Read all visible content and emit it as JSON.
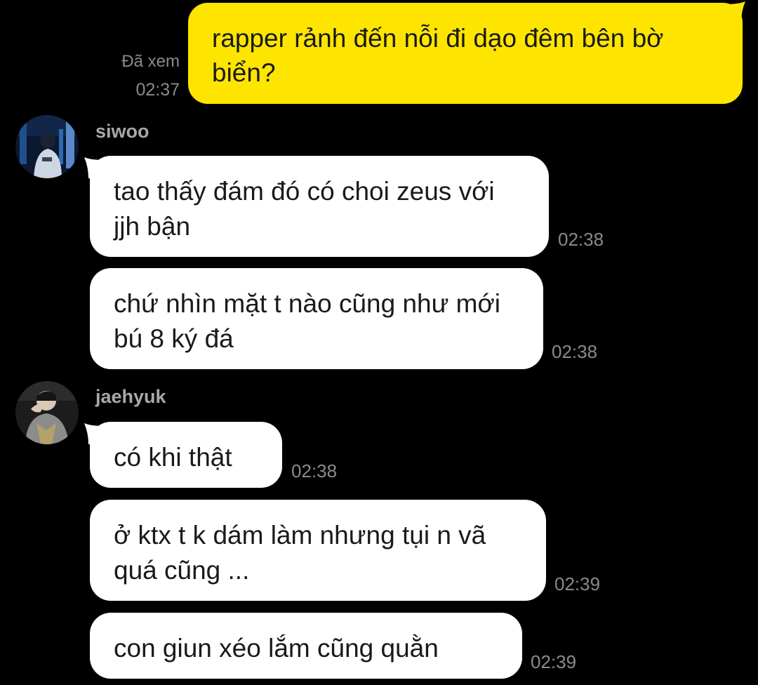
{
  "outgoing": {
    "text": "rapper rảnh đến nỗi đi dạo đêm bên bờ biển?",
    "read_status": "Đã xem",
    "time": "02:37"
  },
  "groups": [
    {
      "sender": "siwoo",
      "avatar_icon": "siwoo-avatar-photo",
      "messages": [
        {
          "text": "tao thấy đám đó có choi zeus với jjh bận",
          "time": "02:38"
        },
        {
          "text": "chứ nhìn mặt t nào cũng như mới bú 8 ký đá",
          "time": "02:38"
        }
      ]
    },
    {
      "sender": "jaehyuk",
      "avatar_icon": "jaehyuk-avatar-photo",
      "messages": [
        {
          "text": "có khi thật",
          "time": "02:38"
        },
        {
          "text": "ở ktx t k dám làm nhưng tụi n vã quá cũng ...",
          "time": "02:39"
        },
        {
          "text": "con giun xéo lắm cũng quằn",
          "time": "02:39"
        }
      ]
    }
  ],
  "colors": {
    "background": "#000000",
    "outgoing_bubble": "#FEE500",
    "incoming_bubble": "#FFFFFF",
    "meta_text": "#8A8A8A"
  }
}
